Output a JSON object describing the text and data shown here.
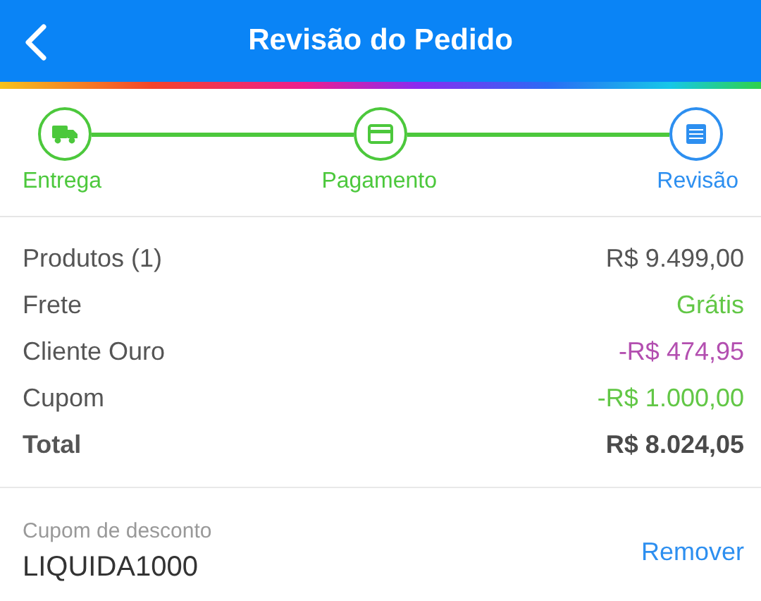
{
  "header": {
    "title": "Revisão do Pedido"
  },
  "steps": [
    {
      "label": "Entrega",
      "selected": false,
      "kind": "truck"
    },
    {
      "label": "Pagamento",
      "selected": false,
      "kind": "card"
    },
    {
      "label": "Revisão",
      "selected": true,
      "kind": "list"
    }
  ],
  "summary": [
    {
      "label": "Produtos (1)",
      "value": "R$ 9.499,00",
      "kind": "line",
      "color": "#555555"
    },
    {
      "label": "Frete",
      "value": "Grátis",
      "kind": "line",
      "color": "#62c746"
    },
    {
      "label": "Cliente Ouro",
      "value": "-R$ 474,95",
      "kind": "line",
      "color": "#b34fb0"
    },
    {
      "label": "Cupom",
      "value": "-R$ 1.000,00",
      "kind": "line",
      "color": "#62c746"
    },
    {
      "label": "Total",
      "value": "R$ 8.024,05",
      "kind": "total",
      "color": "#4a4a4a"
    }
  ],
  "coupon": {
    "label": "Cupom de desconto",
    "code": "LIQUIDA1000",
    "action": "Remover"
  }
}
